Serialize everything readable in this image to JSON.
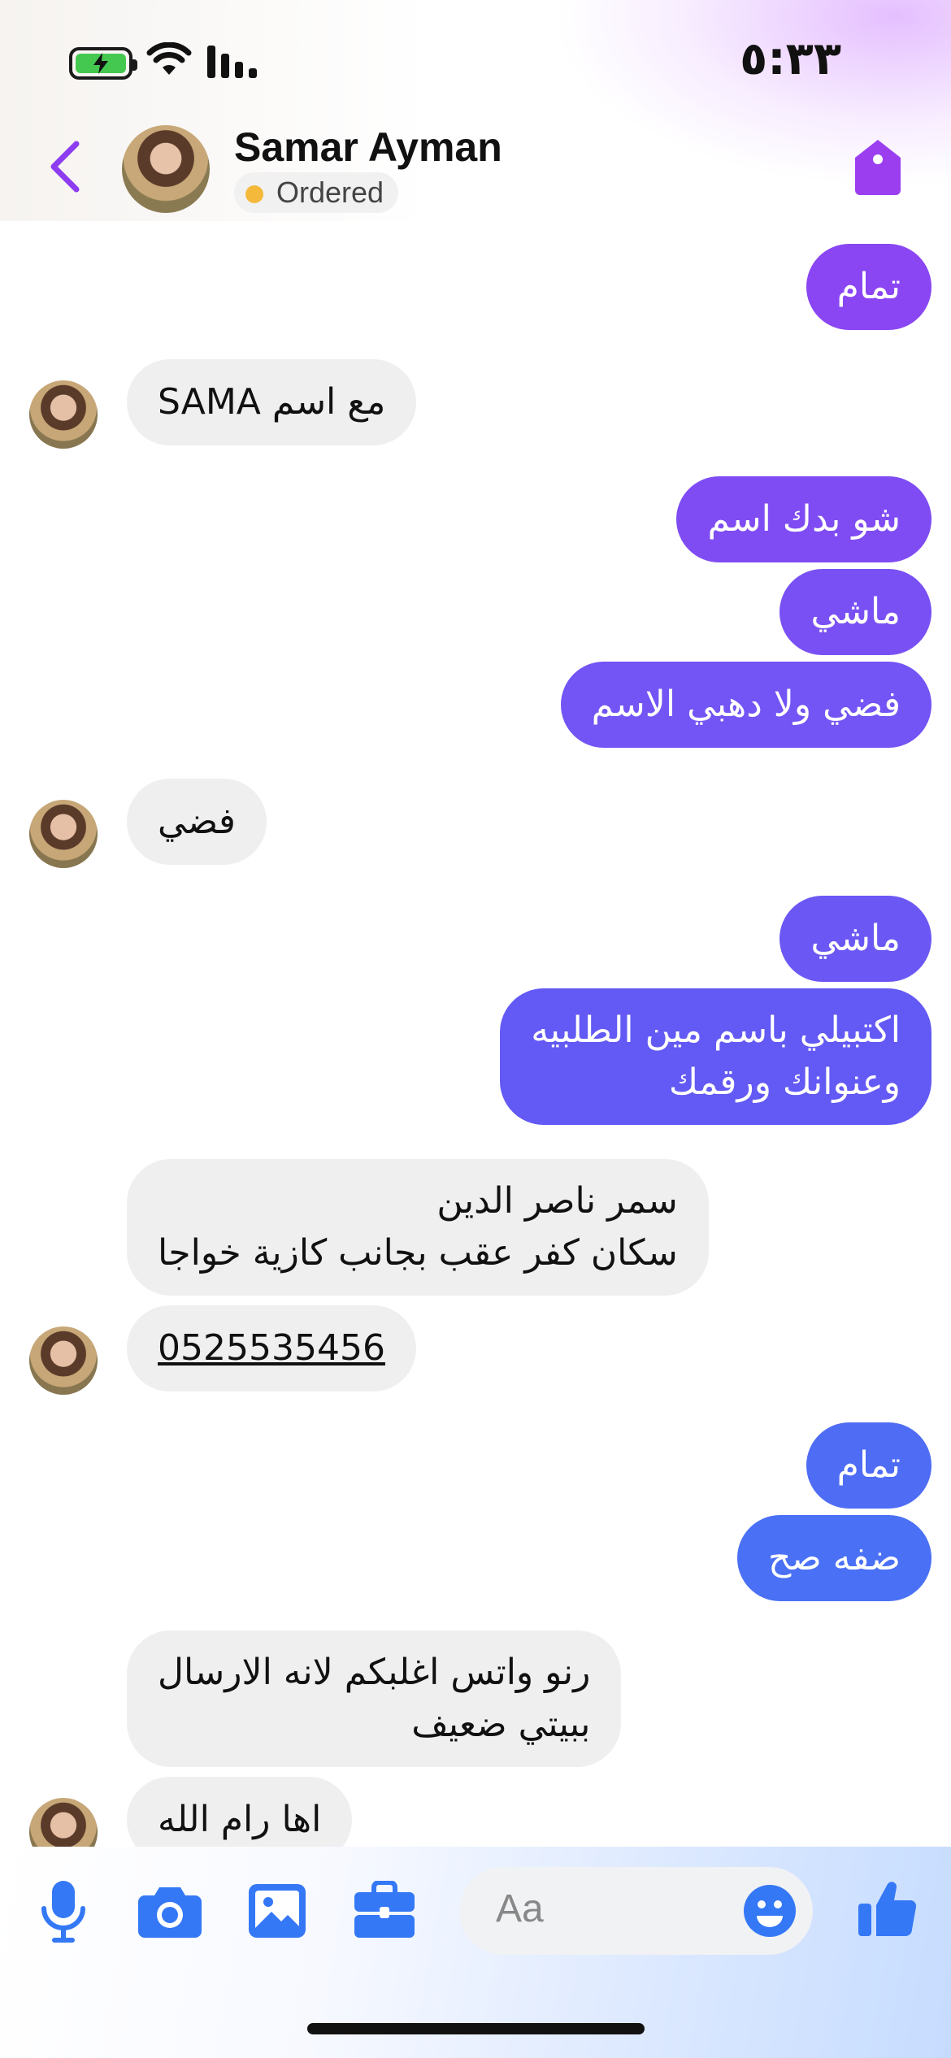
{
  "status_bar": {
    "time": "٥:٣٣"
  },
  "header": {
    "contact_name": "Samar Ayman",
    "status_label": "Ordered",
    "accent": "#8e3cf0"
  },
  "messages": [
    {
      "dir": "out",
      "text": "تمام"
    },
    {
      "dir": "in",
      "text": "مع اسم SAMA"
    },
    {
      "dir": "out",
      "text": "شو بدك اسم"
    },
    {
      "dir": "out",
      "text": "ماشي"
    },
    {
      "dir": "out",
      "text": "فضي ولا دهبي الاسم"
    },
    {
      "dir": "in",
      "text": "فضي"
    },
    {
      "dir": "out",
      "text": "ماشي"
    },
    {
      "dir": "out",
      "lines": [
        "اكتبيلي باسم مين الطلبيه",
        "وعنوانك ورقمك"
      ]
    },
    {
      "dir": "in",
      "lines": [
        "سمر ناصر الدين",
        "سكان كفر عقب بجانب كازية خواجا"
      ]
    },
    {
      "dir": "in",
      "text": "0525535456"
    },
    {
      "dir": "out",
      "text": "تمام"
    },
    {
      "dir": "out",
      "text": "ضفه صح"
    },
    {
      "dir": "in",
      "lines": [
        "رنو واتس اغلبكم لانه الارسال",
        "ببيتي ضعيف"
      ]
    },
    {
      "dir": "in",
      "text": "اها رام الله"
    }
  ],
  "composer": {
    "placeholder": "Aa",
    "icons": [
      "microphone-icon",
      "camera-icon",
      "image-icon",
      "briefcase-icon",
      "emoji-icon",
      "thumbs-up-icon"
    ],
    "icon_color": "#3478f6"
  }
}
